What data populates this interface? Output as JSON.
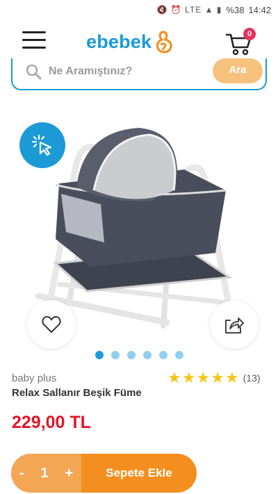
{
  "statusbar": {
    "icons": "🔇 ⏰ LTE ▲ ▮",
    "battery": "%38",
    "time": "14:42"
  },
  "header": {
    "logo_text": "ebebek",
    "cart_count": "0"
  },
  "search": {
    "placeholder": "Ne Aramıştınız?",
    "button_label": "Ara"
  },
  "gallery": {
    "image_count": 6,
    "active_index": 0
  },
  "product": {
    "brand": "baby plus",
    "name": "Relax Sallanır Beşik Füme",
    "rating": 5,
    "review_count": "(13)",
    "price": "229,00 TL"
  },
  "cart": {
    "minus_label": "-",
    "quantity": "1",
    "plus_label": "+",
    "add_label": "Sepete Ekle"
  },
  "colors": {
    "brand_blue": "#1b9ad6",
    "accent_orange": "#f48f1f",
    "price_red": "#e3142b",
    "star": "#f5c518"
  }
}
